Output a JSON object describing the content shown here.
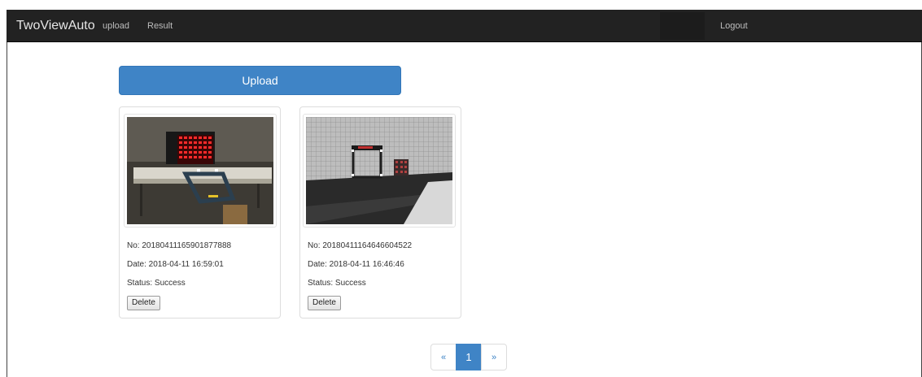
{
  "navbar": {
    "brand": "TwoViewAuto",
    "links": {
      "upload": "upload",
      "result": "Result",
      "logout": "Logout"
    }
  },
  "main": {
    "upload_button": "Upload",
    "cards": [
      {
        "no": "No: 20180411165901877888",
        "date": "Date: 2018-04-11 16:59:01",
        "status": "Status: Success",
        "delete": "Delete"
      },
      {
        "no": "No: 20180411164646604522",
        "date": "Date: 2018-04-11 16:46:46",
        "status": "Status: Success",
        "delete": "Delete"
      }
    ]
  },
  "pagination": {
    "prev": "«",
    "current": "1",
    "next": "»"
  },
  "colors": {
    "navbar_bg": "#222222",
    "primary": "#3f84c6"
  }
}
